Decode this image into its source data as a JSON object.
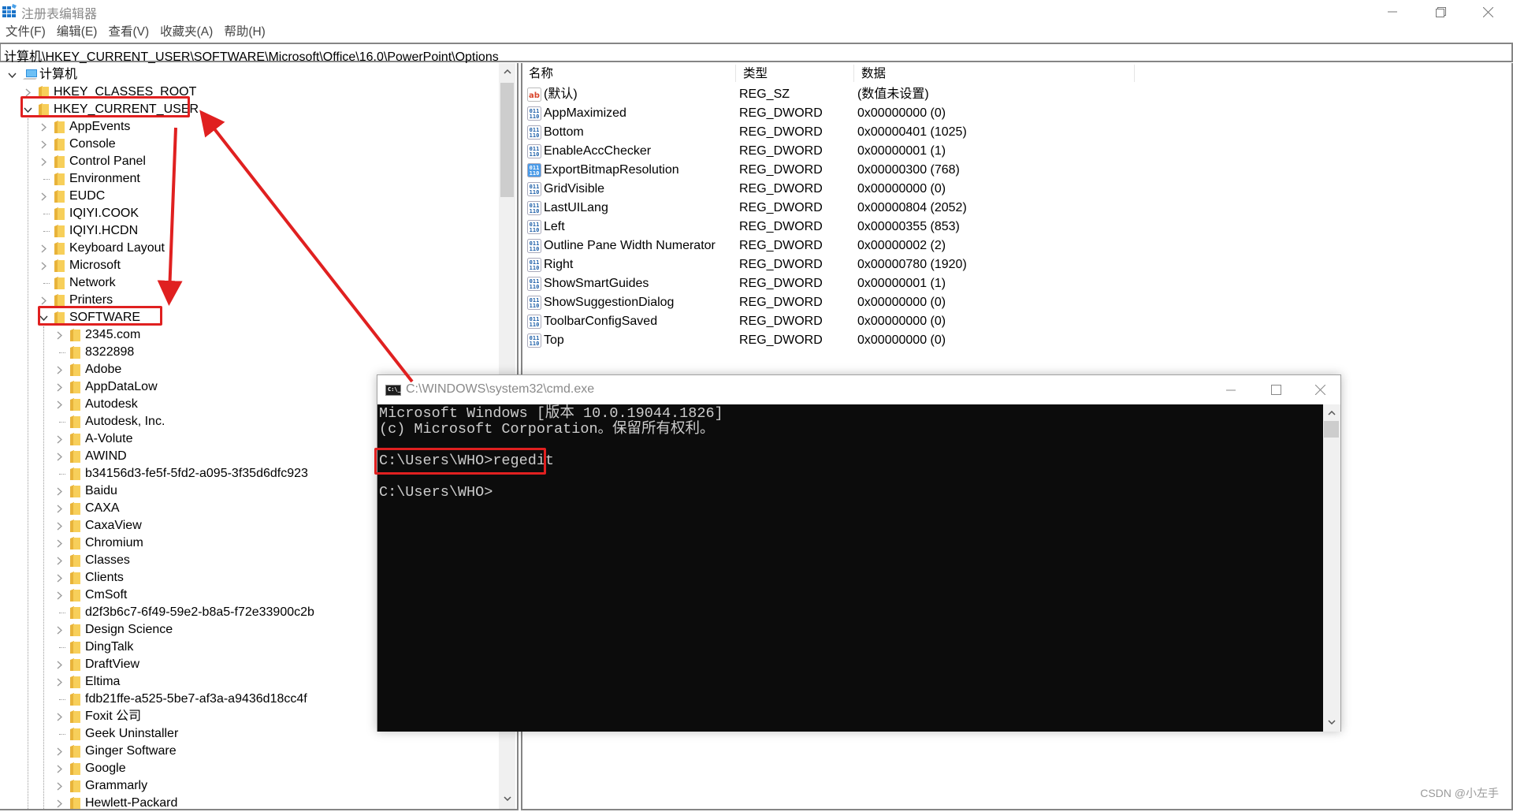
{
  "window": {
    "title": "注册表编辑器",
    "controls": {
      "minimize": "minimize",
      "restore": "restore",
      "close": "close"
    }
  },
  "menu": [
    "文件(F)",
    "编辑(E)",
    "查看(V)",
    "收藏夹(A)",
    "帮助(H)"
  ],
  "address": "计算机\\HKEY_CURRENT_USER\\SOFTWARE\\Microsoft\\Office\\16.0\\PowerPoint\\Options",
  "tree": {
    "root": {
      "label": "计算机",
      "icon": "computer-icon",
      "expanded": true
    },
    "hives": [
      {
        "label": "HKEY_CLASSES_ROOT",
        "expandable": true,
        "expanded": false
      },
      {
        "label": "HKEY_CURRENT_USER",
        "expandable": true,
        "expanded": true,
        "highlighted": true
      }
    ],
    "hkcu_children": [
      {
        "label": "AppEvents",
        "expandable": true
      },
      {
        "label": "Console",
        "expandable": true
      },
      {
        "label": "Control Panel",
        "expandable": true
      },
      {
        "label": "Environment",
        "expandable": false
      },
      {
        "label": "EUDC",
        "expandable": true
      },
      {
        "label": "IQIYI.COOK",
        "expandable": false
      },
      {
        "label": "IQIYI.HCDN",
        "expandable": false
      },
      {
        "label": "Keyboard Layout",
        "expandable": true
      },
      {
        "label": "Microsoft",
        "expandable": true
      },
      {
        "label": "Network",
        "expandable": false
      },
      {
        "label": "Printers",
        "expandable": true
      },
      {
        "label": "SOFTWARE",
        "expandable": true,
        "expanded": true,
        "highlighted": true
      }
    ],
    "software_children": [
      {
        "label": "2345.com",
        "expandable": true
      },
      {
        "label": "8322898",
        "expandable": false
      },
      {
        "label": "Adobe",
        "expandable": true
      },
      {
        "label": "AppDataLow",
        "expandable": true
      },
      {
        "label": "Autodesk",
        "expandable": true
      },
      {
        "label": "Autodesk, Inc.",
        "expandable": false
      },
      {
        "label": "A-Volute",
        "expandable": true
      },
      {
        "label": "AWIND",
        "expandable": true
      },
      {
        "label": "b34156d3-fe5f-5fd2-a095-3f35d6dfc923",
        "expandable": false
      },
      {
        "label": "Baidu",
        "expandable": true
      },
      {
        "label": "CAXA",
        "expandable": true
      },
      {
        "label": "CaxaView",
        "expandable": true
      },
      {
        "label": "Chromium",
        "expandable": true
      },
      {
        "label": "Classes",
        "expandable": true
      },
      {
        "label": "Clients",
        "expandable": true
      },
      {
        "label": "CmSoft",
        "expandable": true
      },
      {
        "label": "d2f3b6c7-6f49-59e2-b8a5-f72e33900c2b",
        "expandable": false
      },
      {
        "label": "Design Science",
        "expandable": true
      },
      {
        "label": "DingTalk",
        "expandable": false
      },
      {
        "label": "DraftView",
        "expandable": true
      },
      {
        "label": "Eltima",
        "expandable": true
      },
      {
        "label": "fdb21ffe-a525-5be7-af3a-a9436d18cc4f",
        "expandable": false
      },
      {
        "label": "Foxit 公司",
        "expandable": true
      },
      {
        "label": "Geek Uninstaller",
        "expandable": false
      },
      {
        "label": "Ginger Software",
        "expandable": true
      },
      {
        "label": "Google",
        "expandable": true
      },
      {
        "label": "Grammarly",
        "expandable": true
      },
      {
        "label": "Hewlett-Packard",
        "expandable": true
      }
    ]
  },
  "values": {
    "columns": [
      "名称",
      "类型",
      "数据"
    ],
    "rows": [
      {
        "name": "(默认)",
        "type": "REG_SZ",
        "data": "(数值未设置)",
        "icon": "string-value-icon"
      },
      {
        "name": "AppMaximized",
        "type": "REG_DWORD",
        "data": "0x00000000 (0)",
        "icon": "binary-value-icon"
      },
      {
        "name": "Bottom",
        "type": "REG_DWORD",
        "data": "0x00000401 (1025)",
        "icon": "binary-value-icon"
      },
      {
        "name": "EnableAccChecker",
        "type": "REG_DWORD",
        "data": "0x00000001 (1)",
        "icon": "binary-value-icon"
      },
      {
        "name": "ExportBitmapResolution",
        "type": "REG_DWORD",
        "data": "0x00000300 (768)",
        "icon": "binary-value-icon",
        "selected_icon": true
      },
      {
        "name": "GridVisible",
        "type": "REG_DWORD",
        "data": "0x00000000 (0)",
        "icon": "binary-value-icon"
      },
      {
        "name": "LastUILang",
        "type": "REG_DWORD",
        "data": "0x00000804 (2052)",
        "icon": "binary-value-icon"
      },
      {
        "name": "Left",
        "type": "REG_DWORD",
        "data": "0x00000355 (853)",
        "icon": "binary-value-icon"
      },
      {
        "name": "Outline Pane Width Numerator",
        "type": "REG_DWORD",
        "data": "0x00000002 (2)",
        "icon": "binary-value-icon"
      },
      {
        "name": "Right",
        "type": "REG_DWORD",
        "data": "0x00000780 (1920)",
        "icon": "binary-value-icon"
      },
      {
        "name": "ShowSmartGuides",
        "type": "REG_DWORD",
        "data": "0x00000001 (1)",
        "icon": "binary-value-icon"
      },
      {
        "name": "ShowSuggestionDialog",
        "type": "REG_DWORD",
        "data": "0x00000000 (0)",
        "icon": "binary-value-icon"
      },
      {
        "name": "ToolbarConfigSaved",
        "type": "REG_DWORD",
        "data": "0x00000000 (0)",
        "icon": "binary-value-icon"
      },
      {
        "name": "Top",
        "type": "REG_DWORD",
        "data": "0x00000000 (0)",
        "icon": "binary-value-icon"
      }
    ]
  },
  "cmd": {
    "title": "C:\\WINDOWS\\system32\\cmd.exe",
    "icon_text": "C:\\_",
    "lines": [
      "Microsoft Windows [版本 10.0.19044.1826]",
      "(c) Microsoft Corporation。保留所有权利。",
      "",
      "C:\\Users\\WHO>regedit",
      "",
      "C:\\Users\\WHO>"
    ]
  },
  "watermark": "CSDN @小左手",
  "colors": {
    "annotation": "#e02020",
    "folder": "#f5c342",
    "console_bg": "#0c0c0c",
    "console_text": "#cccccc",
    "border": "#858585"
  }
}
